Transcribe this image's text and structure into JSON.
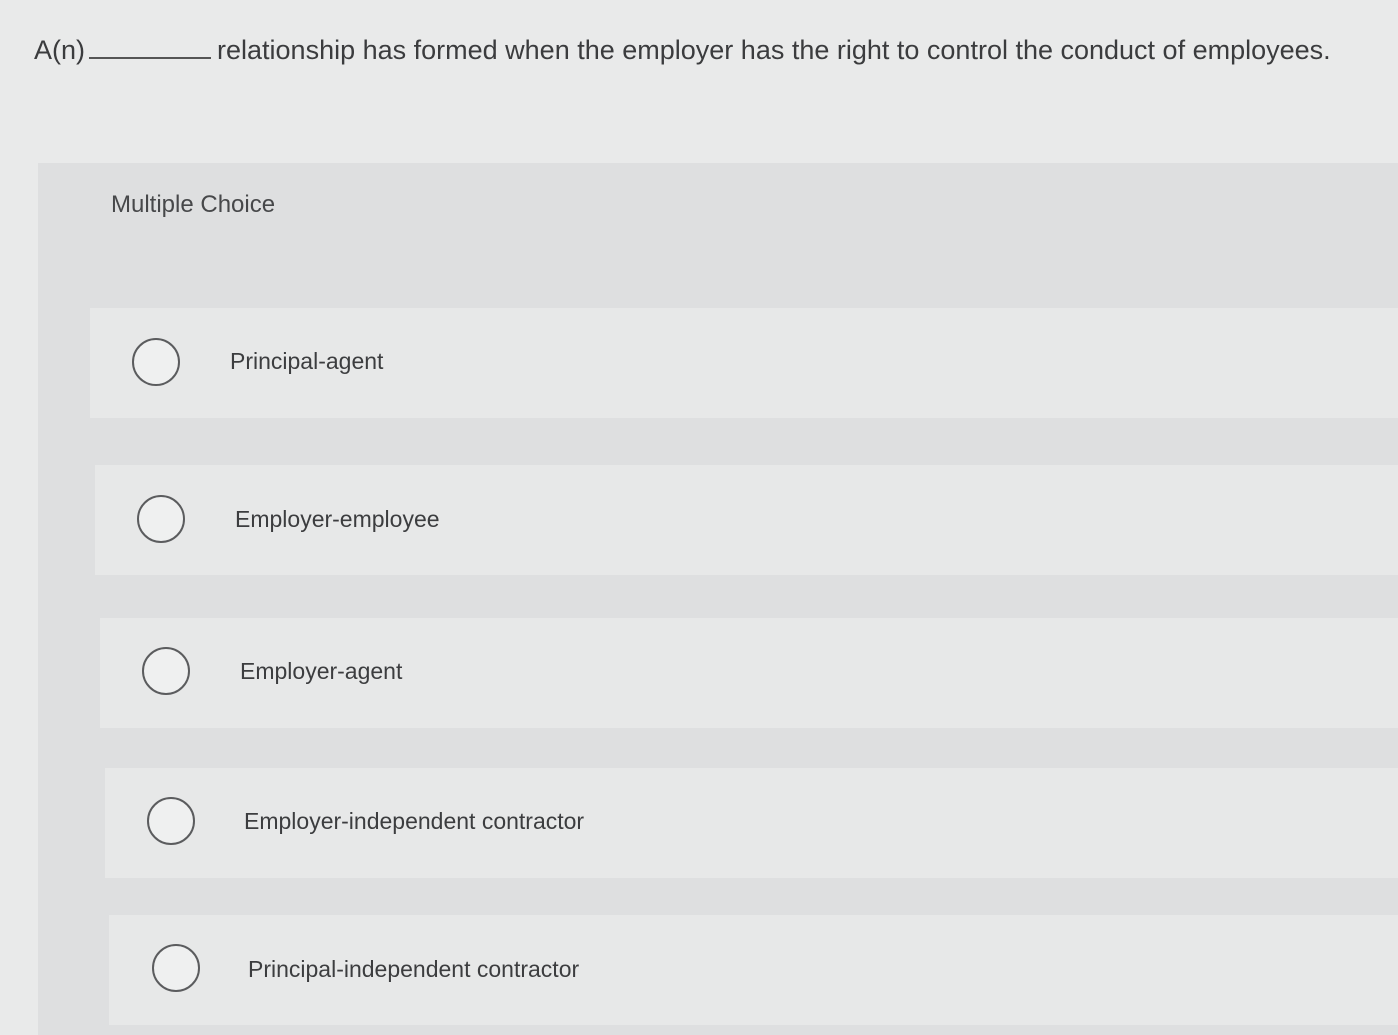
{
  "question": {
    "prefix": "A(n)",
    "suffix": "relationship has formed when the employer has the right to control the conduct of employees."
  },
  "multiple_choice": {
    "label": "Multiple Choice",
    "options": [
      {
        "label": "Principal-agent"
      },
      {
        "label": "Employer-employee"
      },
      {
        "label": "Employer-agent"
      },
      {
        "label": "Employer-independent contractor"
      },
      {
        "label": "Principal-independent contractor"
      }
    ]
  }
}
